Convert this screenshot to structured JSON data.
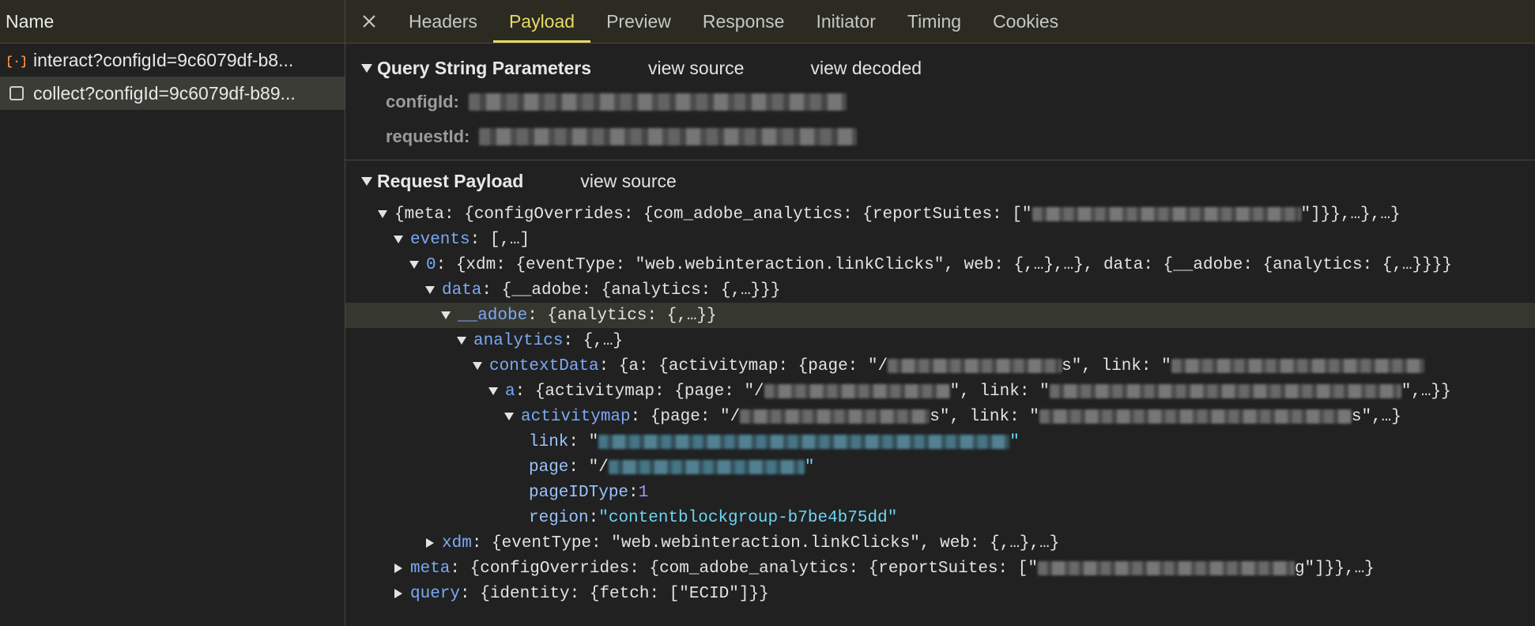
{
  "left": {
    "header": "Name",
    "requests": [
      {
        "icon": "json-braces-icon",
        "label": "interact?configId=9c6079df-b8...",
        "selected": false
      },
      {
        "icon": "checkbox-icon",
        "label": "collect?configId=9c6079df-b89...",
        "selected": true
      }
    ]
  },
  "tabs": [
    "Headers",
    "Payload",
    "Preview",
    "Response",
    "Initiator",
    "Timing",
    "Cookies"
  ],
  "active_tab": "Payload",
  "query_section": {
    "title": "Query String Parameters",
    "view_source": "view source",
    "view_decoded": "view decoded",
    "params": [
      {
        "key": "configId:"
      },
      {
        "key": "requestId:"
      }
    ]
  },
  "payload_section": {
    "title": "Request Payload",
    "view_source": "view source"
  },
  "tree": {
    "root": "{meta: {configOverrides: {com_adobe_analytics: {reportSuites: [\"",
    "root_end": "\"]}},…},…}",
    "events_key": "events",
    "events_val": ": [,…]",
    "e0_key": "0",
    "e0_val": ": {xdm: {eventType: \"web.webinteraction.linkClicks\", web: {,…},…}, data: {__adobe: {analytics: {,…}}}}",
    "data_key": "data",
    "data_val": ": {__adobe: {analytics: {,…}}}",
    "adobe_key": "__adobe",
    "adobe_val": ": {analytics: {,…}}",
    "analytics_key": "analytics",
    "analytics_val": ": {,…}",
    "context_key": "contextData",
    "context_val_a": ": {a: {activitymap: {page: \"/",
    "context_val_b": "s\", link: \"",
    "a_key": "a",
    "a_val_a": ": {activitymap: {page: \"/",
    "a_val_b": "\", link: \"",
    "a_val_c": "\",…}}",
    "am_key": "activitymap",
    "am_val_a": ": {page: \"/",
    "am_val_b": "s\", link: \"",
    "am_val_c": "s\",…}",
    "link_key": "link",
    "link_val_a": ": \"",
    "link_val_b": "\"",
    "page_key": "page",
    "page_val_a": ": \"/",
    "page_val_b": "\"",
    "pageid_key": "pageIDType",
    "pageid_val": "1",
    "region_key": "region",
    "region_val": "\"contentblockgroup-b7be4b75dd\"",
    "xdm_key": "xdm",
    "xdm_val": ": {eventType: \"web.webinteraction.linkClicks\", web: {,…},…}",
    "meta_key": "meta",
    "meta_val_a": ": {configOverrides: {com_adobe_analytics: {reportSuites: [\"",
    "meta_val_b": "g\"]}},…}",
    "query_key": "query",
    "query_val": ": {identity: {fetch: [\"ECID\"]}}"
  }
}
